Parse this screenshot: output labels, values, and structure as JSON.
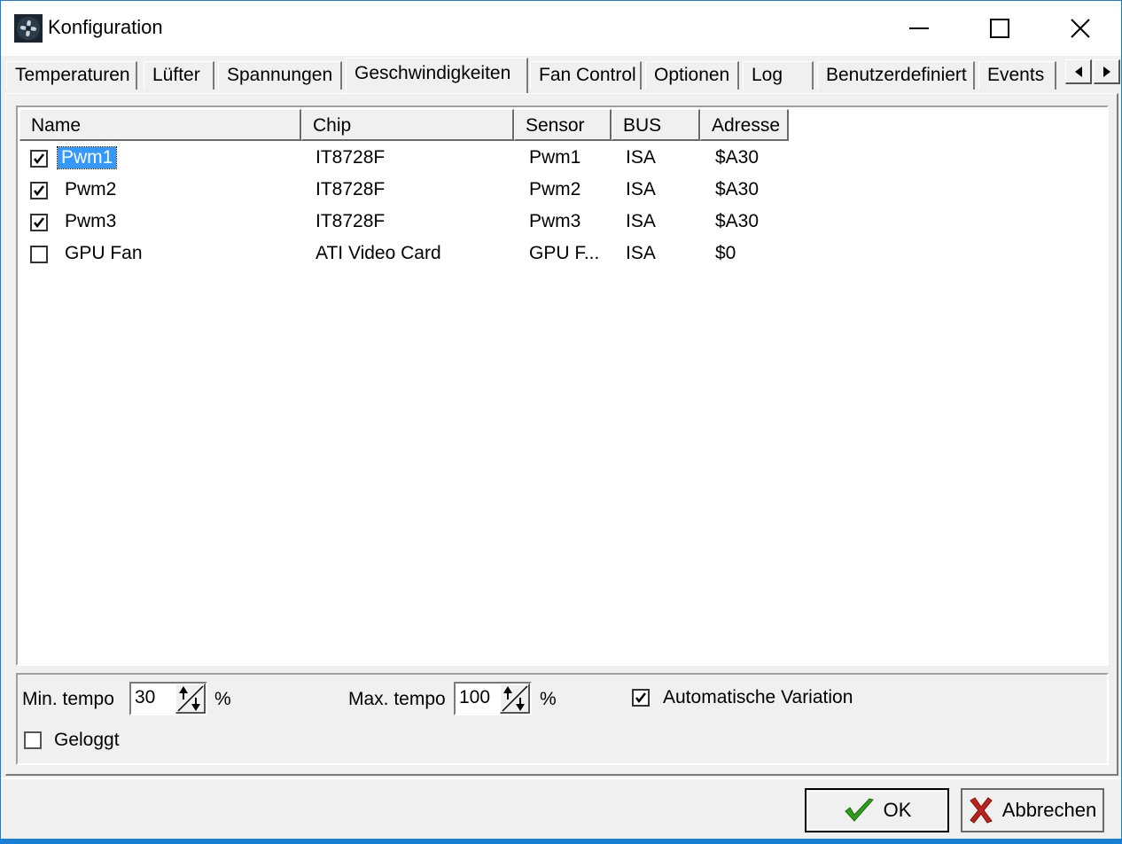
{
  "window": {
    "title": "Konfiguration",
    "controls": {
      "minimize": "minimize",
      "maximize": "maximize",
      "close": "close"
    }
  },
  "tabs": [
    {
      "label": "Temperaturen",
      "active": false
    },
    {
      "label": "Lüfter",
      "active": false
    },
    {
      "label": "Spannungen",
      "active": false
    },
    {
      "label": "Geschwindigkeiten",
      "active": true
    },
    {
      "label": "Fan Control",
      "active": false
    },
    {
      "label": "Optionen",
      "active": false
    },
    {
      "label": "Log",
      "active": false
    },
    {
      "label": "Benutzerdefiniert",
      "active": false
    },
    {
      "label": "Events",
      "active": false
    }
  ],
  "list": {
    "columns": [
      "Name",
      "Chip",
      "Sensor",
      "BUS",
      "Adresse"
    ],
    "rows": [
      {
        "checked": true,
        "name": "Pwm1",
        "chip": "IT8728F",
        "sensor": "Pwm1",
        "bus": "ISA",
        "address": "$A30",
        "selected": true
      },
      {
        "checked": true,
        "name": "Pwm2",
        "chip": "IT8728F",
        "sensor": "Pwm2",
        "bus": "ISA",
        "address": "$A30",
        "selected": false
      },
      {
        "checked": true,
        "name": "Pwm3",
        "chip": "IT8728F",
        "sensor": "Pwm3",
        "bus": "ISA",
        "address": "$A30",
        "selected": false
      },
      {
        "checked": false,
        "name": "GPU Fan",
        "chip": "ATI Video Card",
        "sensor": "GPU F...",
        "bus": "ISA",
        "address": "$0",
        "selected": false
      }
    ]
  },
  "options": {
    "min_label": "Min. tempo",
    "min_value": "30",
    "min_unit": "%",
    "max_label": "Max. tempo",
    "max_value": "100",
    "max_unit": "%",
    "auto_variation_label": "Automatische Variation",
    "auto_variation_checked": true,
    "logged_label": "Geloggt",
    "logged_checked": false
  },
  "footer": {
    "ok_label": "OK",
    "cancel_label": "Abbrechen"
  },
  "colors": {
    "selection": "#3399ff",
    "ok_icon": "#2e9e1a",
    "cancel_icon": "#c0201a",
    "window_border": "#1a7fd4"
  }
}
